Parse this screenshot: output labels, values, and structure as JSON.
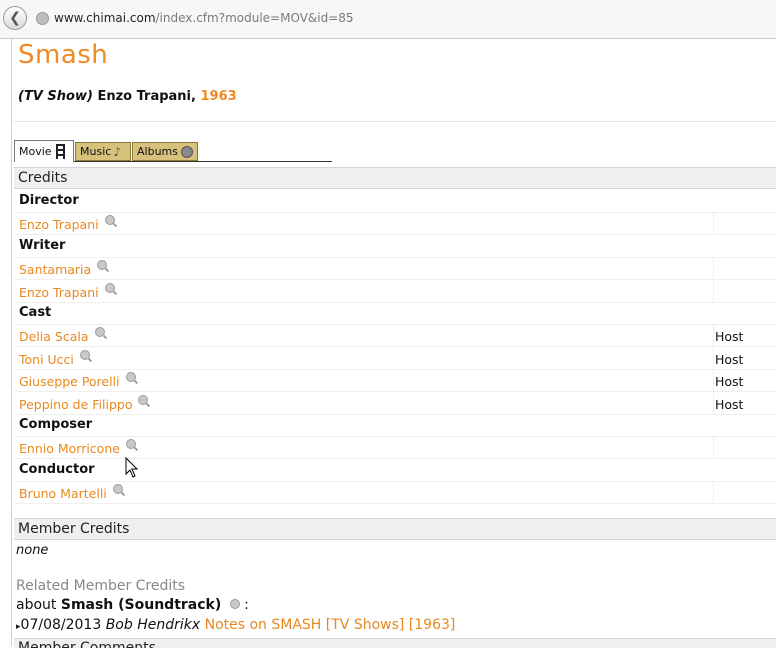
{
  "browser": {
    "url_host": "www.chimai.com",
    "url_path": "/index.cfm?module=MOV&id=85"
  },
  "page": {
    "title": "Smash",
    "type_label": "(TV Show)",
    "director": "Enzo Trapani,",
    "year": "1963"
  },
  "tabs": [
    {
      "label": "Movie",
      "icon": "film-icon",
      "active": true
    },
    {
      "label": "Music",
      "icon": "music-note-icon",
      "active": false
    },
    {
      "label": "Albums",
      "icon": "disc-icon",
      "active": false
    }
  ],
  "credits": {
    "heading": "Credits",
    "rows": [
      {
        "kind": "role",
        "text": "Director"
      },
      {
        "kind": "person",
        "text": "Enzo Trapani",
        "note": ""
      },
      {
        "kind": "role",
        "text": "Writer"
      },
      {
        "kind": "person",
        "text": "Santamaria",
        "note": ""
      },
      {
        "kind": "person",
        "text": "Enzo Trapani",
        "note": ""
      },
      {
        "kind": "role",
        "text": "Cast"
      },
      {
        "kind": "person",
        "text": "Delia Scala",
        "note": "Host"
      },
      {
        "kind": "person",
        "text": "Toni Ucci",
        "note": "Host"
      },
      {
        "kind": "person",
        "text": "Giuseppe Porelli",
        "note": "Host"
      },
      {
        "kind": "person",
        "text": "Peppino de Filippo",
        "note": "Host"
      },
      {
        "kind": "role",
        "text": "Composer"
      },
      {
        "kind": "person",
        "text": "Ennio Morricone",
        "note": ""
      },
      {
        "kind": "role",
        "text": "Conductor"
      },
      {
        "kind": "person",
        "text": "Bruno Martelli",
        "note": ""
      }
    ]
  },
  "member_credits": {
    "heading": "Member Credits",
    "value": "none"
  },
  "related": {
    "heading": "Related Member Credits",
    "about_prefix": "about",
    "about_title": "Smash (Soundtrack)",
    "about_suffix": ":",
    "entry_date": "07/08/2013",
    "entry_author": "Bob Hendrikx",
    "entry_link": "Notes on SMASH [TV Shows] [1963]"
  },
  "bottom": {
    "heading": "Member Comments"
  },
  "colors": {
    "accent": "#f08a24",
    "tab_bg": "#d6c27c"
  }
}
